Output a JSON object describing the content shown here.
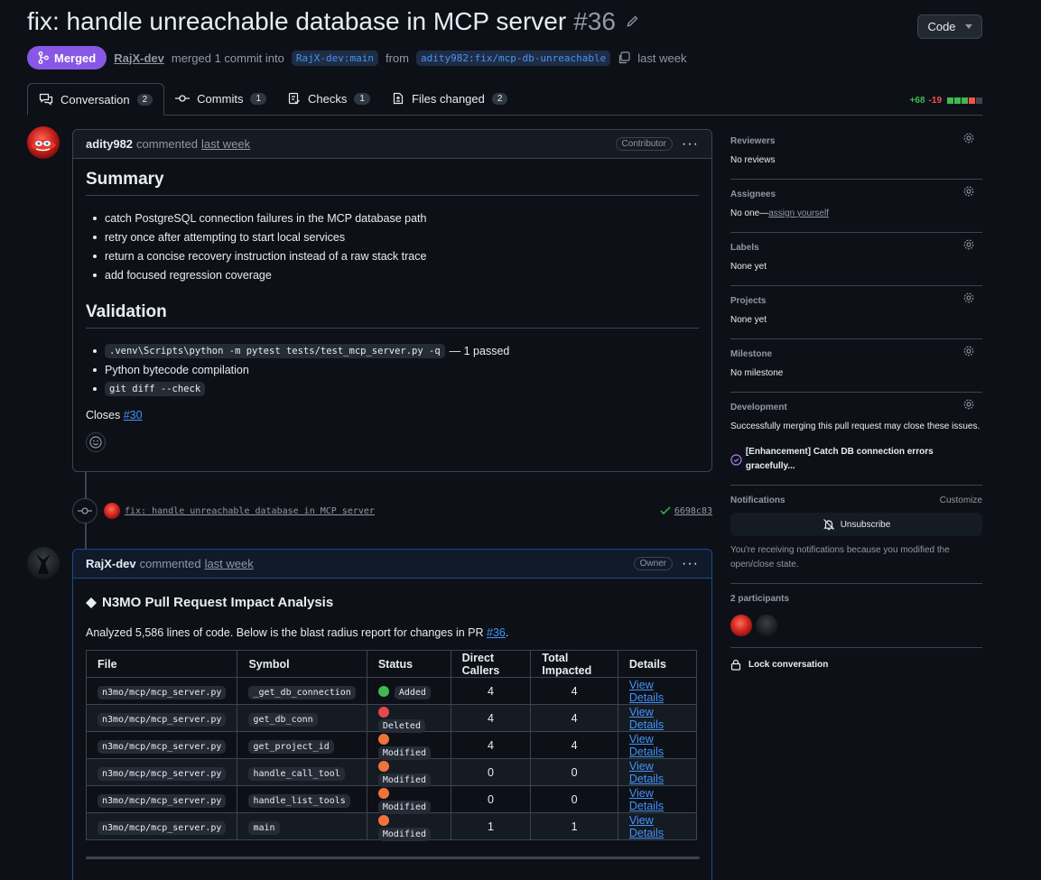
{
  "header": {
    "title": "fix: handle unreachable database in MCP server",
    "number": "#36",
    "code_button": "Code",
    "state": "Merged",
    "author": "RajX-dev",
    "merge_text": "merged 1 commit into",
    "base_branch": "RajX-dev:main",
    "from_text": "from",
    "head_branch": "adity982:fix/mcp-db-unreachable",
    "time": "last week"
  },
  "tabs": [
    {
      "label": "Conversation",
      "count": "2"
    },
    {
      "label": "Commits",
      "count": "1"
    },
    {
      "label": "Checks",
      "count": "1"
    },
    {
      "label": "Files changed",
      "count": "2"
    }
  ],
  "diffstat": {
    "additions": "+68",
    "deletions": "-19"
  },
  "comment1": {
    "author": "adity982",
    "action": "commented",
    "time": "last week",
    "role": "Contributor",
    "summary_heading": "Summary",
    "summary_items": [
      "catch PostgreSQL connection failures in the MCP database path",
      "retry once after attempting to start local services",
      "return a concise recovery instruction instead of a raw stack trace",
      "add focused regression coverage"
    ],
    "validation_heading": "Validation",
    "validation_cmd1": ".venv\\Scripts\\python -m pytest tests/test_mcp_server.py -q",
    "validation_cmd1_result": "— 1 passed",
    "validation_item2": "Python bytecode compilation",
    "validation_cmd3": "git diff --check",
    "closes_text": "Closes",
    "closes_ref": "#30"
  },
  "commit": {
    "message": "fix: handle unreachable database in MCP server",
    "sha": "6698c83"
  },
  "comment2": {
    "author": "RajX-dev",
    "action": "commented",
    "time": "last week",
    "role": "Owner",
    "heading": "N3MO Pull Request Impact Analysis",
    "intro_prefix": "Analyzed 5,586 lines of code. Below is the blast radius report for changes in PR",
    "intro_ref": "#36",
    "intro_suffix": ".",
    "table": {
      "headers": [
        "File",
        "Symbol",
        "Status",
        "Direct Callers",
        "Total Impacted",
        "Details"
      ],
      "rows": [
        {
          "file": "n3mo/mcp/mcp_server.py",
          "symbol": "_get_db_connection",
          "status": "Added",
          "status_color": "#3fb950",
          "direct": "4",
          "total": "4",
          "details": "View Details"
        },
        {
          "file": "n3mo/mcp/mcp_server.py",
          "symbol": "get_db_conn",
          "status": "Deleted",
          "status_color": "#e5484d",
          "direct": "4",
          "total": "4",
          "details": "View Details"
        },
        {
          "file": "n3mo/mcp/mcp_server.py",
          "symbol": "get_project_id",
          "status": "Modified",
          "status_color": "#f0743a",
          "direct": "4",
          "total": "4",
          "details": "View Details"
        },
        {
          "file": "n3mo/mcp/mcp_server.py",
          "symbol": "handle_call_tool",
          "status": "Modified",
          "status_color": "#f0743a",
          "direct": "0",
          "total": "0",
          "details": "View Details"
        },
        {
          "file": "n3mo/mcp/mcp_server.py",
          "symbol": "handle_list_tools",
          "status": "Modified",
          "status_color": "#f0743a",
          "direct": "0",
          "total": "0",
          "details": "View Details"
        },
        {
          "file": "n3mo/mcp/mcp_server.py",
          "symbol": "main",
          "status": "Modified",
          "status_color": "#f0743a",
          "direct": "1",
          "total": "1",
          "details": "View Details"
        }
      ]
    }
  },
  "sidebar": {
    "reviewers": {
      "title": "Reviewers",
      "value": "No reviews"
    },
    "assignees": {
      "title": "Assignees",
      "value": "No one—",
      "link": "assign yourself"
    },
    "labels": {
      "title": "Labels",
      "value": "None yet"
    },
    "projects": {
      "title": "Projects",
      "value": "None yet"
    },
    "milestone": {
      "title": "Milestone",
      "value": "No milestone"
    },
    "development": {
      "title": "Development",
      "value": "Successfully merging this pull request may close these issues.",
      "issue": "[Enhancement] Catch DB connection errors gracefully..."
    },
    "notifications": {
      "title": "Notifications",
      "customize": "Customize",
      "button": "Unsubscribe",
      "note": "You're receiving notifications because you modified the open/close state."
    },
    "participants": {
      "title": "2 participants"
    },
    "lock": "Lock conversation"
  }
}
